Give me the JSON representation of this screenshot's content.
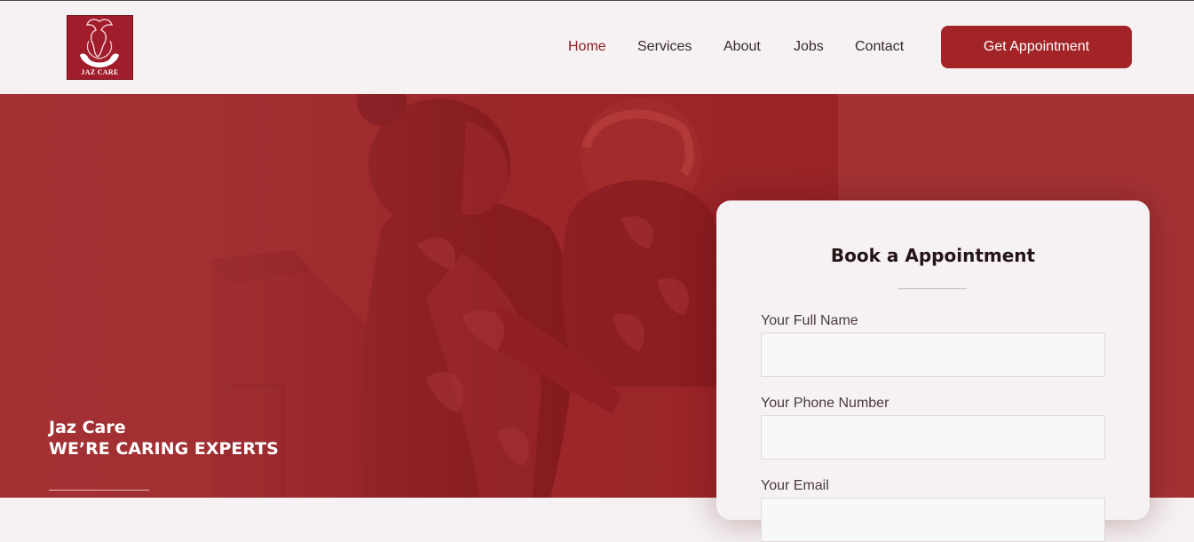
{
  "header": {
    "logo_text": "JAZ CARE",
    "nav": [
      {
        "label": "Home",
        "active": true
      },
      {
        "label": "Services",
        "active": false
      },
      {
        "label": "About",
        "active": false
      },
      {
        "label": "Jobs",
        "active": false
      },
      {
        "label": "Contact",
        "active": false
      }
    ],
    "cta_label": "Get Appointment"
  },
  "hero": {
    "brand": "Jaz Care",
    "tagline": "WE’RE CARING EXPERTS"
  },
  "form": {
    "title": "Book a Appointment",
    "fields": [
      {
        "label": "Your Full Name",
        "value": "",
        "placeholder": ""
      },
      {
        "label": "Your Phone Number",
        "value": "",
        "placeholder": ""
      },
      {
        "label": "Your Email",
        "value": "",
        "placeholder": ""
      }
    ]
  },
  "colors": {
    "brand_red": "#a22426",
    "hero_bg": "#a43235",
    "nav_active": "#8e1f25",
    "card_bg": "#f6f1f2"
  }
}
